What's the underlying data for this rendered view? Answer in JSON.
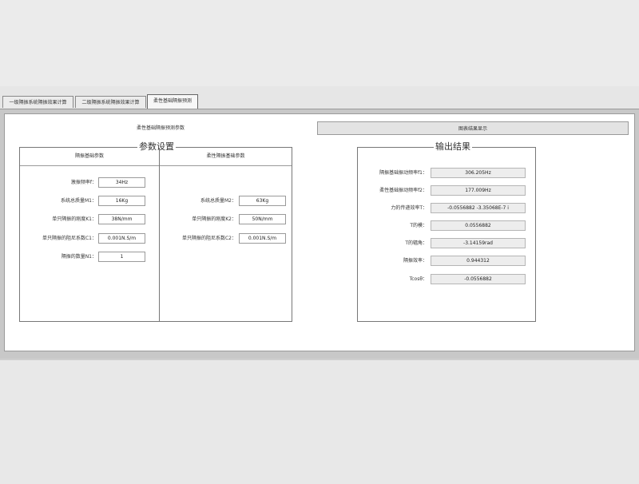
{
  "tabs": [
    {
      "label": "一级隔振系统隔振效果计算"
    },
    {
      "label": "二级隔振系统隔振效果计算"
    },
    {
      "label": "柔性基础隔振预测"
    }
  ],
  "subtabs": {
    "params": "柔性基础隔振预测参数",
    "graph": "图表结果显示"
  },
  "param_group": {
    "title": "参数设置",
    "left_header": "隔振基础参数",
    "right_header": "柔性隔振基础参数",
    "left_fields": [
      {
        "label": "激振频率f：",
        "value": "34Hz"
      },
      {
        "label": "系统总质量M1：",
        "value": "16Kg"
      },
      {
        "label": "单只隔振的刚度K1：",
        "value": "38N/mm"
      },
      {
        "label": "单只隔振的阻尼系数C1：",
        "value": "0.001N.S/m"
      },
      {
        "label": "隔振的数量N1：",
        "value": "1"
      }
    ],
    "right_fields": [
      {
        "label": "系统总质量M2：",
        "value": "63Kg"
      },
      {
        "label": "单只隔振的刚度K2：",
        "value": "50N/mm"
      },
      {
        "label": "单只隔振的阻尼系数C2：",
        "value": "0.001N.S/m"
      }
    ]
  },
  "output_group": {
    "title": "输出结果",
    "fields": [
      {
        "label": "隔振基础振动频率f1：",
        "value": "306.205Hz"
      },
      {
        "label": "柔性基础振动频率f2：",
        "value": "177.009Hz"
      },
      {
        "label": "力的传递效率T：",
        "value": "-0.0556882 -3.35068E-7 i"
      },
      {
        "label": "T的模：",
        "value": "0.0556882"
      },
      {
        "label": "T的辐角：",
        "value": "-3.14159rad"
      },
      {
        "label": "隔振效率：",
        "value": "0.944312"
      },
      {
        "label": "Tcosθ：",
        "value": "-0.0556882"
      }
    ]
  }
}
